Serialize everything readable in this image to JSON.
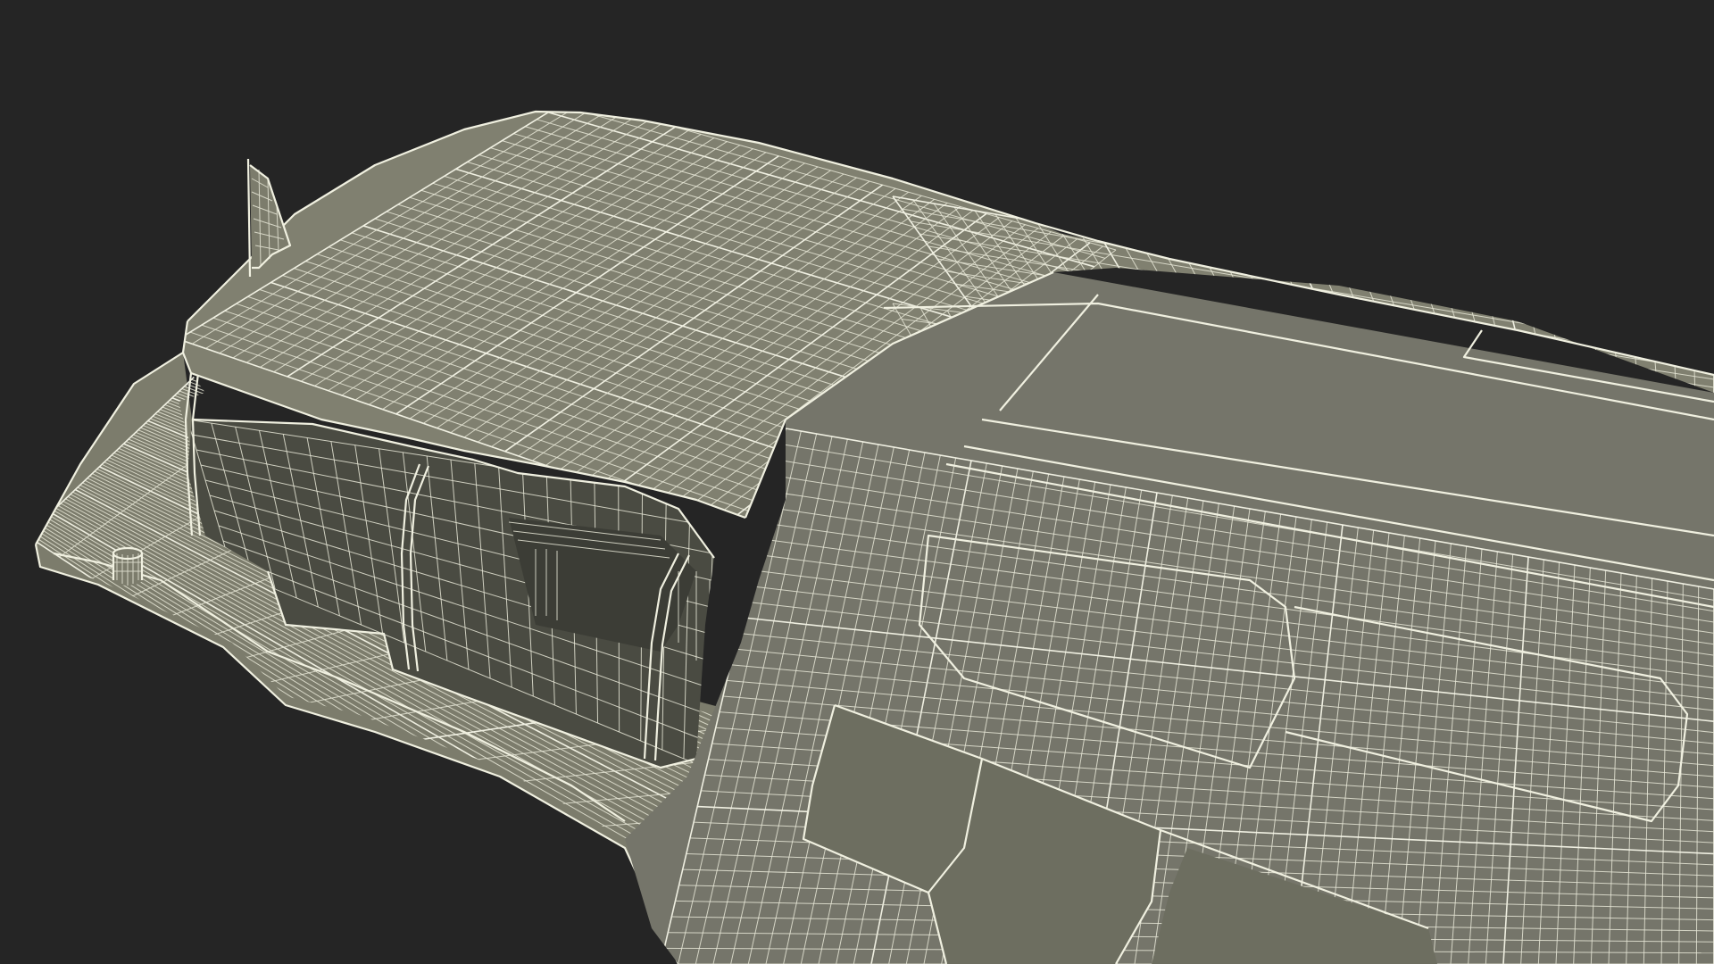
{
  "scene": {
    "subject": "wireframe-boat",
    "background_color": "#252525",
    "mesh_fill_color": "#7b7b6b",
    "wire_color": "#eeeedf"
  }
}
